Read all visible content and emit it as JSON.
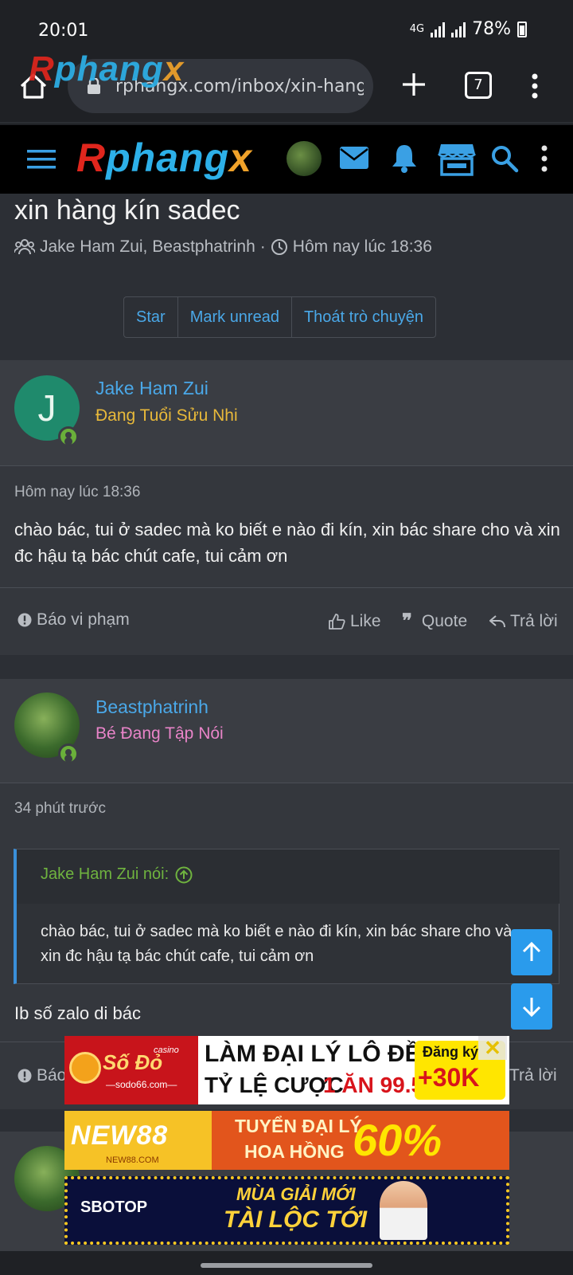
{
  "status_bar": {
    "time": "20:01",
    "network": "4G",
    "battery": "78%"
  },
  "browser": {
    "url": "rphangx.com/inbox/xin-hang-l",
    "tab_count": "7",
    "logo_overlay": "Rphangx"
  },
  "site_header": {
    "logo_part_a": "R",
    "logo_part_b": "phang",
    "logo_part_c": "x"
  },
  "thread": {
    "title": "xin hàng kín sadec",
    "participants": "Jake Ham Zui, Beastphatrinh",
    "separator": "·",
    "time": "Hôm nay lúc 18:36",
    "actions": [
      "Star",
      "Mark unread",
      "Thoát trò chuyện"
    ]
  },
  "messages": [
    {
      "username": "Jake Ham Zui",
      "user_title": "Đang Tuổi Sửu Nhi",
      "avatar_letter": "J",
      "time": "Hôm nay lúc 18:36",
      "body": "chào bác, tui ở sadec mà ko biết e nào đi kín, xin bác share cho và xin đc hậu tạ bác chút cafe, tui cảm ơn",
      "report_label": "Báo vi phạm",
      "like_label": "Like",
      "quote_label": "Quote",
      "reply_label": "Trả lời"
    },
    {
      "username": "Beastphatrinh",
      "user_title": "Bé Đang Tập Nói",
      "time": "34 phút trước",
      "quote_author": "Jake Ham Zui nói:",
      "quote_text": "chào bác, tui ở sadec mà ko biết e nào đi kín, xin bác share cho và xin đc hậu tạ bác chút cafe, tui cảm ơn",
      "body": "Ib số zalo di bác",
      "report_label": "Báo",
      "reply_label": "Trả lời"
    }
  ],
  "ads": {
    "ad1": {
      "brand": "Số Đỏ",
      "brand_tag": "casino",
      "site": "—sodo66.com—",
      "line1": "LÀM ĐẠI LÝ LÔ ĐỀ",
      "line2a": "TỶ LỆ CƯỢC",
      "line2b": "1 ĂN 99.5",
      "badge_top": "Đăng ký",
      "badge_bottom": "+30K"
    },
    "ad2": {
      "brand": "NEW88",
      "site": "NEW88.COM",
      "line1": "TUYỂN ĐẠI LÝ",
      "line2": "HOA HỒNG",
      "percent": "60%"
    },
    "ad3": {
      "brand": "SBOTOP",
      "line1": "MÙA GIẢI MỚI",
      "line2": "TÀI LỘC TỚI"
    }
  },
  "colors": {
    "accent": "#4aa8e8",
    "online": "#6ab03a",
    "title_gold": "#e8b93a",
    "title_pink": "#e884c8",
    "quote_green": "#6fb33f"
  }
}
